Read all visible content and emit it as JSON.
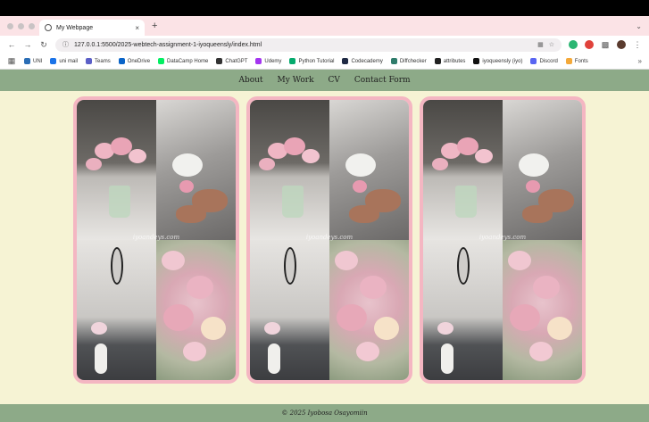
{
  "browser": {
    "tab": {
      "title": "My Webpage",
      "close": "×"
    },
    "new_tab": "+",
    "address": {
      "url": "127.0.0.1:5500/2025-webtech-assignment-1-iyoqueensly/index.html"
    },
    "bookmarks": [
      {
        "label": "UNI",
        "color": "#2a6db5"
      },
      {
        "label": "uni mail",
        "color": "#1a73e8"
      },
      {
        "label": "Teams",
        "color": "#5b5fc7"
      },
      {
        "label": "OneDrive",
        "color": "#0a64c8"
      },
      {
        "label": "DataCamp Home",
        "color": "#03ef62"
      },
      {
        "label": "ChatGPT",
        "color": "#333333"
      },
      {
        "label": "Udemy",
        "color": "#a435f0"
      },
      {
        "label": "Python Tutorial",
        "color": "#04aa6d"
      },
      {
        "label": "Codecademy",
        "color": "#1f2a44"
      },
      {
        "label": "Diffchecker",
        "color": "#2f7c6b"
      },
      {
        "label": "attributes",
        "color": "#222222"
      },
      {
        "label": "iyoqueensly (iyo)",
        "color": "#111111"
      },
      {
        "label": "Discord",
        "color": "#5865f2"
      },
      {
        "label": "Fonts",
        "color": "#f4a93a"
      }
    ],
    "bookmarks_more": "»"
  },
  "site": {
    "nav": [
      "About",
      "My Work",
      "CV",
      "Contact Form"
    ],
    "watermark": "iyoandeys.com",
    "footer": "© 2025 Iyobosa Osayomiin"
  },
  "colors": {
    "nav_bg": "#8daa88",
    "page_bg": "#f6f3d4",
    "card_border": "#f4b6c2",
    "tabstrip_bg": "#fbe3e6"
  }
}
